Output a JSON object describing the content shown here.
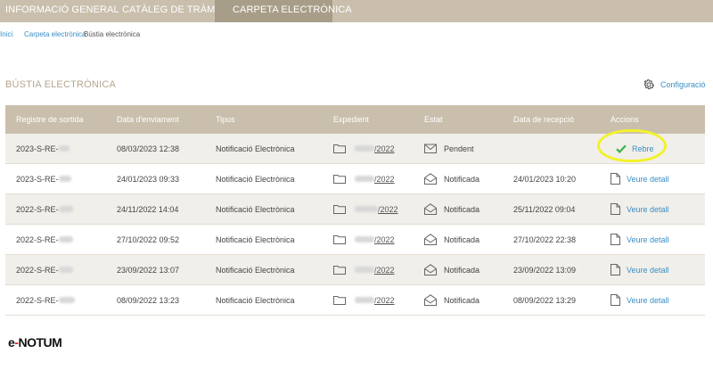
{
  "topnav": {
    "tabs": [
      "INFORMACIÓ GENERAL",
      "CATÀLEG DE TRÀMITS",
      "CARPETA ELECTRÒNICA"
    ]
  },
  "breadcrumb": [
    "Inici",
    "Carpeta electrònica",
    "Bústia electrònica"
  ],
  "section_title": "BÚSTIA ELECTRÒNICA",
  "config_label": "Configuració",
  "table": {
    "headers": [
      "Registre de sortida",
      "Data d'enviament",
      "Tipus",
      "Expedient",
      "Estat",
      "Data de recepció",
      "Accions"
    ],
    "rows": [
      {
        "registre": "2023-S-RE-",
        "data_enviament": "08/03/2023 12:38",
        "tipus": "Notificació Electrònica",
        "expedient": "/2022",
        "estat": "Pendent",
        "estat_icon": "envelope-closed-icon",
        "data_recepcio": "",
        "accio": "Rebre",
        "accio_icon": "check-icon"
      },
      {
        "registre": "2023-S-RE-",
        "data_enviament": "24/01/2023 09:33",
        "tipus": "Notificació Electrònica",
        "expedient": "/2022",
        "estat": "Notificada",
        "estat_icon": "envelope-open-icon",
        "data_recepcio": "24/01/2023 10:20",
        "accio": "Veure detall",
        "accio_icon": "document-icon"
      },
      {
        "registre": "2022-S-RE-",
        "data_enviament": "24/11/2022 14:04",
        "tipus": "Notificació Electrònica",
        "expedient": "/2022",
        "estat": "Notificada",
        "estat_icon": "envelope-open-icon",
        "data_recepcio": "25/11/2022 09:04",
        "accio": "Veure detall",
        "accio_icon": "document-icon"
      },
      {
        "registre": "2022-S-RE-",
        "data_enviament": "27/10/2022 09:52",
        "tipus": "Notificació Electrònica",
        "expedient": "/2022",
        "estat": "Notificada",
        "estat_icon": "envelope-open-icon",
        "data_recepcio": "27/10/2022 22:38",
        "accio": "Veure detall",
        "accio_icon": "document-icon"
      },
      {
        "registre": "2022-S-RE-",
        "data_enviament": "23/09/2022 13:07",
        "tipus": "Notificació Electrònica",
        "expedient": "/2022",
        "estat": "Notificada",
        "estat_icon": "envelope-open-icon",
        "data_recepcio": "23/09/2022 13:09",
        "accio": "Veure detall",
        "accio_icon": "document-icon"
      },
      {
        "registre": "2022-S-RE-",
        "data_enviament": "08/09/2022 13:23",
        "tipus": "Notificació Electrònica",
        "expedient": "/2022",
        "estat": "Notificada",
        "estat_icon": "envelope-open-icon",
        "data_recepcio": "08/09/2022 13:29",
        "accio": "Veure detall",
        "accio_icon": "document-icon"
      }
    ]
  },
  "logo": {
    "e": "e",
    "dash": "-",
    "rest": "NOTUM"
  },
  "colors": {
    "header_bg": "#c9bfac",
    "active_tab": "#a89d88",
    "link": "#3a8fc4",
    "title": "#b4a78f",
    "highlight": "#f2f22a",
    "check": "#3cb34a",
    "logo_red": "#d2232a"
  }
}
